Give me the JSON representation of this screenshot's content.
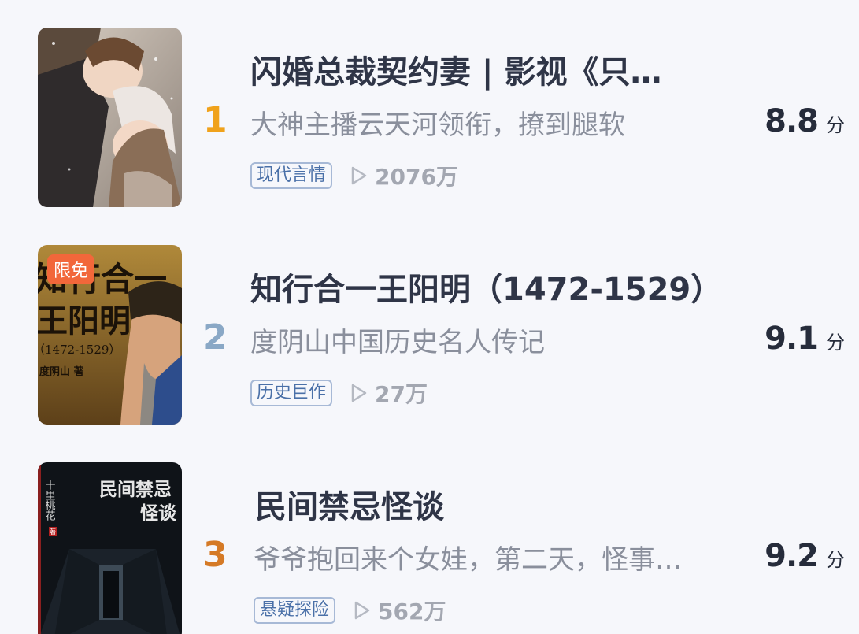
{
  "books": [
    {
      "rank": "1",
      "rank_color": "#f0a21b",
      "title": "闪婚总裁契约妻 | 影视《只…",
      "desc": "大神主播云天河领衔，撩到腿软",
      "tag": "现代言情",
      "plays": "2076万",
      "score": "8.8",
      "score_unit": "分",
      "badge": ""
    },
    {
      "rank": "2",
      "rank_color": "#8aa8c6",
      "title": "知行合一王阳明（1472-1529）",
      "desc": "度阴山中国历史名人传记",
      "tag": "历史巨作",
      "plays": "27万",
      "score": "9.1",
      "score_unit": "分",
      "badge": "限免",
      "cover_text": {
        "line1": "知行合一",
        "line2": "王阳明",
        "line3": "（1472-1529）",
        "author": "度阴山 著"
      }
    },
    {
      "rank": "3",
      "rank_color": "#d57a26",
      "title": "民间禁忌怪谈",
      "desc": "爷爷抱回来个女娃，第二天，怪事…",
      "tag": "悬疑探险",
      "plays": "562万",
      "score": "9.2",
      "score_unit": "分",
      "badge": "",
      "cover_text": {
        "title1": "民间禁忌",
        "title2": "怪谈",
        "author": "十里桃花",
        "seal": "著"
      }
    }
  ]
}
